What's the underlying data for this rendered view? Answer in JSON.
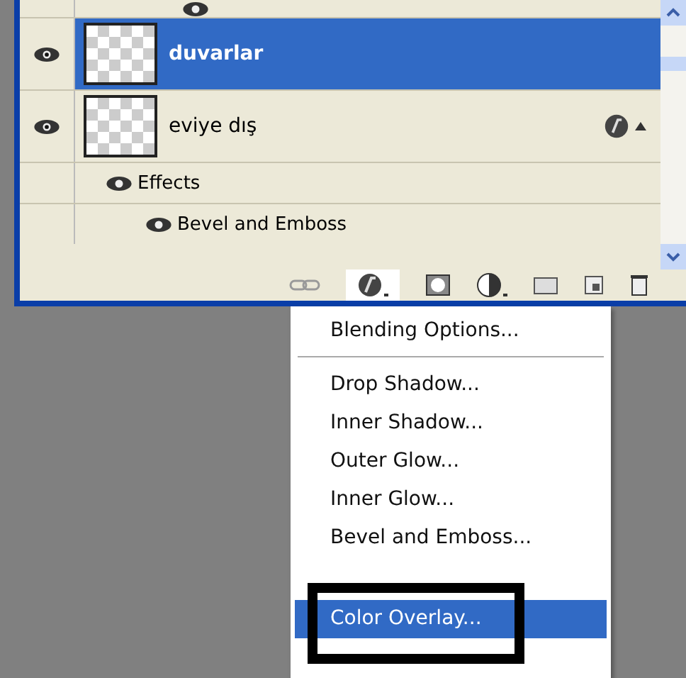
{
  "layers": [
    {
      "name": "duvarlar",
      "selected": true,
      "visible": true,
      "has_effects": false
    },
    {
      "name": "eviye dış",
      "selected": false,
      "visible": true,
      "has_effects": true,
      "children": [
        {
          "name": "Effects",
          "visible": true,
          "children": [
            {
              "name": "Bevel and Emboss",
              "visible": true
            }
          ]
        }
      ]
    }
  ],
  "menu": [
    {
      "kind": "item",
      "label": "Blending Options...",
      "selected": false
    },
    {
      "kind": "separator"
    },
    {
      "kind": "item",
      "label": "Drop Shadow...",
      "selected": false
    },
    {
      "kind": "item",
      "label": "Inner Shadow...",
      "selected": false
    },
    {
      "kind": "item",
      "label": "Outer Glow...",
      "selected": false
    },
    {
      "kind": "item",
      "label": "Inner Glow...",
      "selected": false
    },
    {
      "kind": "item",
      "label": "Bevel and Emboss...",
      "selected": false
    },
    {
      "kind": "covered"
    },
    {
      "kind": "item",
      "label": "Color Overlay...",
      "selected": true
    },
    {
      "kind": "covered"
    }
  ]
}
